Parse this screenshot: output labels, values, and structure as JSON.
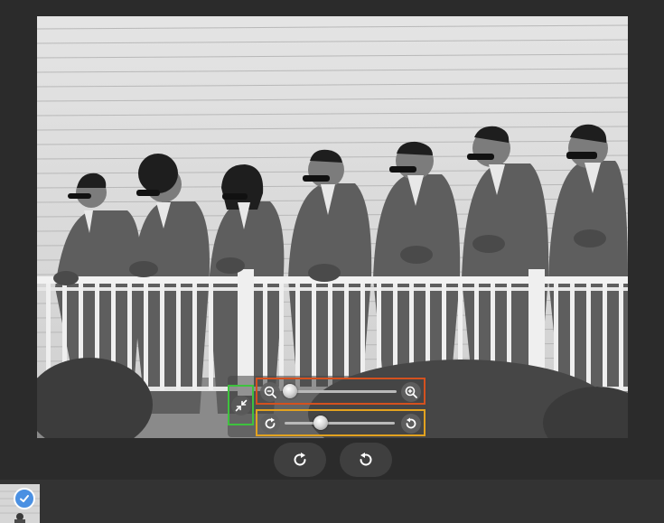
{
  "icons": {
    "fit": "collapse-arrows-icon",
    "zoom_out": "zoom-out-icon",
    "zoom_in": "zoom-in-icon",
    "rotate_right": "rotate-clockwise-icon",
    "rotate_left": "rotate-counterclockwise-icon",
    "selected": "checkmark-icon"
  },
  "controls": {
    "zoom_level": 0.0,
    "rotation_level": 0.33
  },
  "colors": {
    "zoom_highlight": "#d4511f",
    "rotate_highlight": "#e2a21f",
    "fit_highlight": "#3ec23e",
    "selected_badge": "#4a90e2"
  },
  "filmstrip": {
    "items": [
      {
        "selected": true
      }
    ]
  }
}
